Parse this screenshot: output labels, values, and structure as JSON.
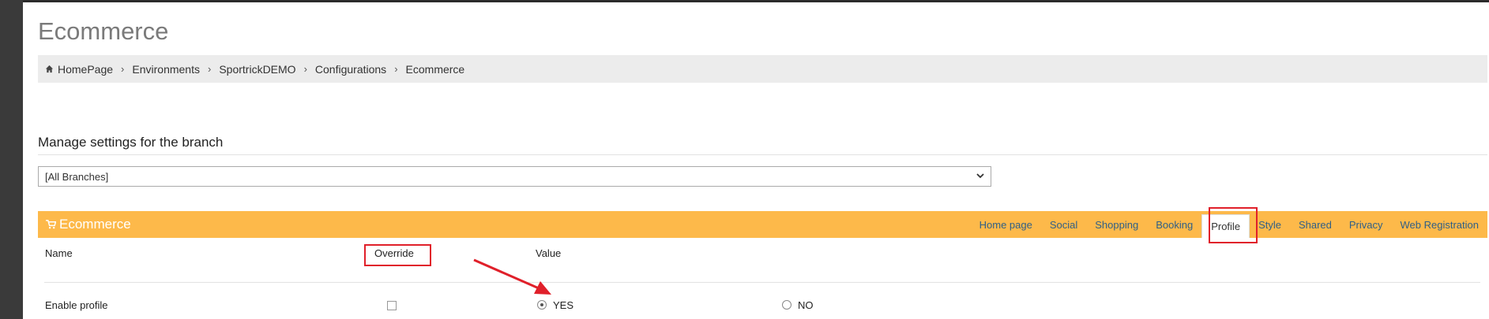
{
  "page": {
    "title": "Ecommerce"
  },
  "breadcrumb": {
    "items": [
      "HomePage",
      "Environments",
      "SportrickDEMO",
      "Configurations",
      "Ecommerce"
    ],
    "separator": "›"
  },
  "branch_settings": {
    "label": "Manage settings for the branch",
    "selected": "[All Branches]"
  },
  "panel": {
    "title": "Ecommerce",
    "tabs": [
      "Home page",
      "Social",
      "Shopping",
      "Booking",
      "Profile",
      "Style",
      "Shared",
      "Privacy",
      "Web Registration"
    ],
    "active_tab": "Profile",
    "accent_color": "#fdb94a"
  },
  "table": {
    "columns": {
      "name": "Name",
      "override": "Override",
      "value": "Value"
    },
    "rows": [
      {
        "name": "Enable profile",
        "override": false,
        "options": [
          "YES",
          "NO"
        ],
        "selected": "YES"
      }
    ]
  },
  "annotation_color": "#e0202a"
}
